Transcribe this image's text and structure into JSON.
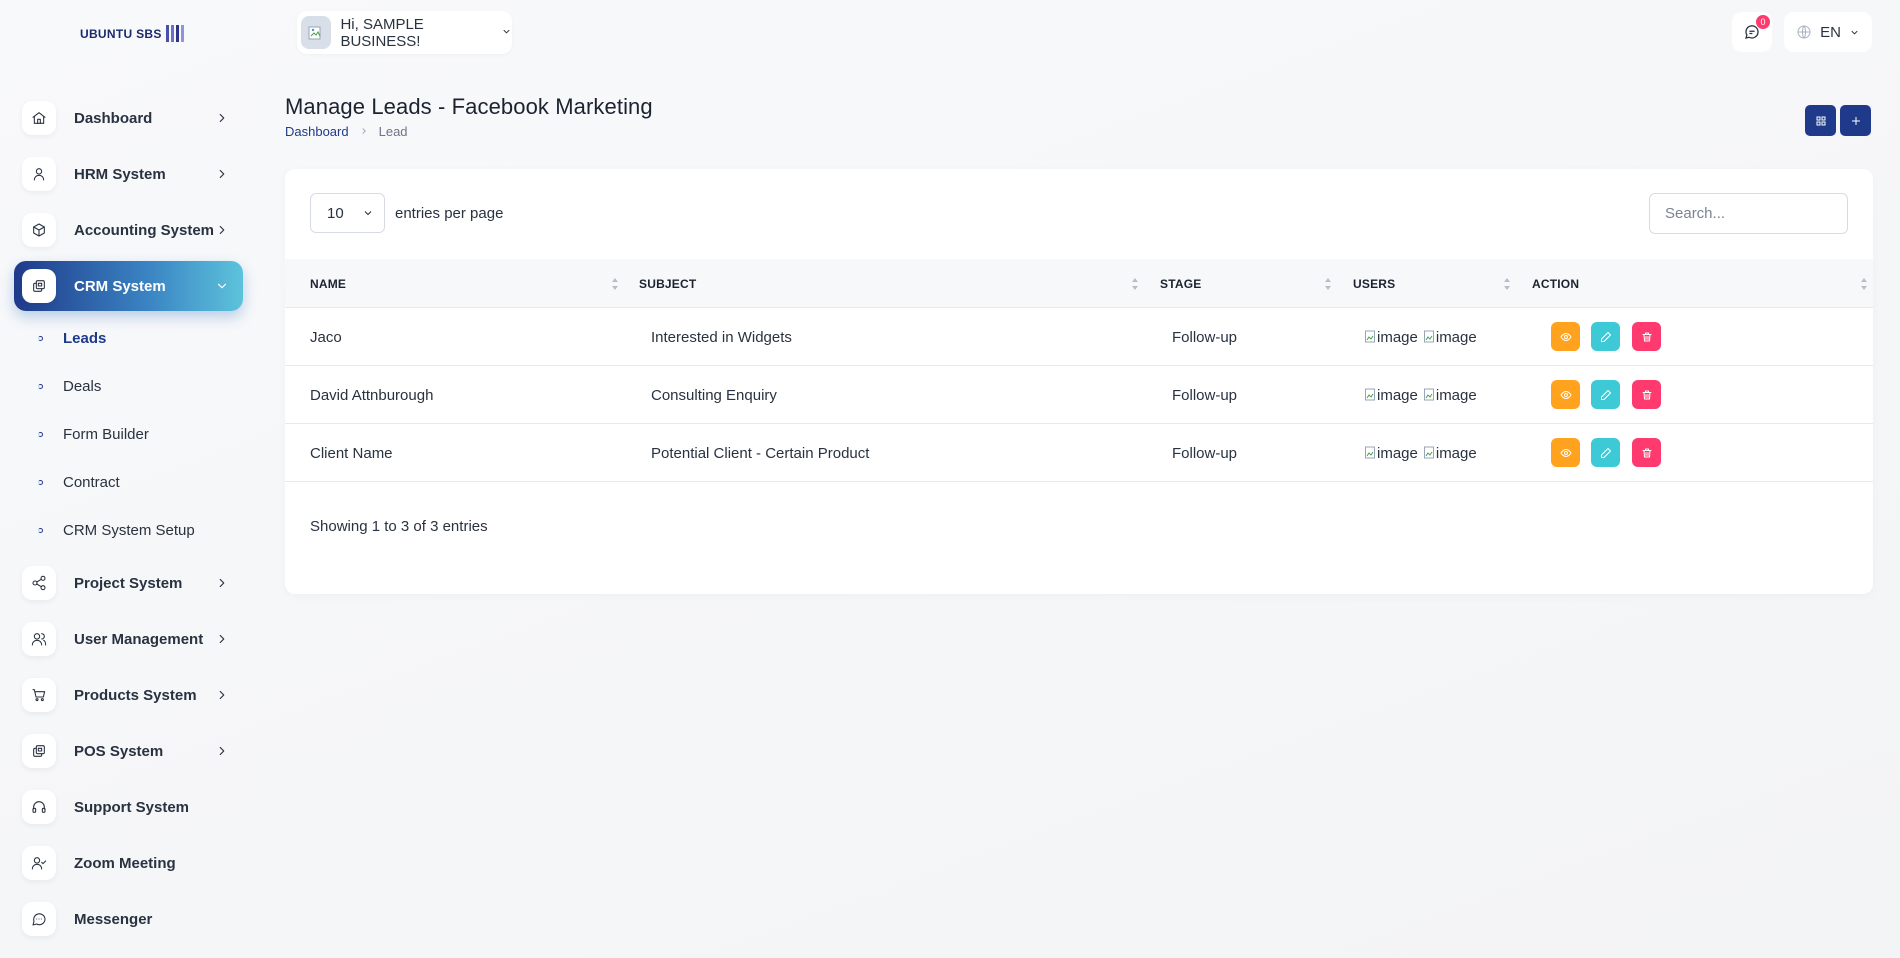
{
  "app": {
    "logo_text": "UBUNTU SBS"
  },
  "sidebar": {
    "items": [
      {
        "label": "Dashboard"
      },
      {
        "label": "HRM System"
      },
      {
        "label": "Accounting System"
      },
      {
        "label": "CRM System"
      },
      {
        "label": "Project System"
      },
      {
        "label": "User Management"
      },
      {
        "label": "Products System"
      },
      {
        "label": "POS System"
      },
      {
        "label": "Support System"
      },
      {
        "label": "Zoom Meeting"
      },
      {
        "label": "Messenger"
      }
    ],
    "crm_subitems": [
      {
        "label": "Leads"
      },
      {
        "label": "Deals"
      },
      {
        "label": "Form Builder"
      },
      {
        "label": "Contract"
      },
      {
        "label": "CRM System Setup"
      }
    ]
  },
  "topbar": {
    "greeting": "Hi, SAMPLE BUSINESS!",
    "notification_count": "0",
    "language": "EN"
  },
  "page": {
    "title": "Manage Leads - Facebook Marketing",
    "breadcrumb": [
      "Dashboard",
      "Lead"
    ]
  },
  "table": {
    "per_page_value": "10",
    "per_page_label": "entries per page",
    "search_placeholder": "Search...",
    "columns": [
      "NAME",
      "SUBJECT",
      "STAGE",
      "USERS",
      "ACTION"
    ],
    "rows": [
      {
        "name": "Jaco",
        "subject": "Interested in Widgets",
        "stage": "Follow-up",
        "users": [
          "image",
          "image"
        ]
      },
      {
        "name": "David Attnburough",
        "subject": "Consulting Enquiry",
        "stage": "Follow-up",
        "users": [
          "image",
          "image"
        ]
      },
      {
        "name": "Client Name",
        "subject": "Potential Client - Certain Product",
        "stage": "Follow-up",
        "users": [
          "image",
          "image"
        ]
      }
    ],
    "footer": "Showing 1 to 3 of 3 entries"
  },
  "colors": {
    "primary": "#1f3a8a",
    "view": "#ffa21d",
    "edit": "#3ec9d6",
    "delete": "#ff3a6e"
  }
}
